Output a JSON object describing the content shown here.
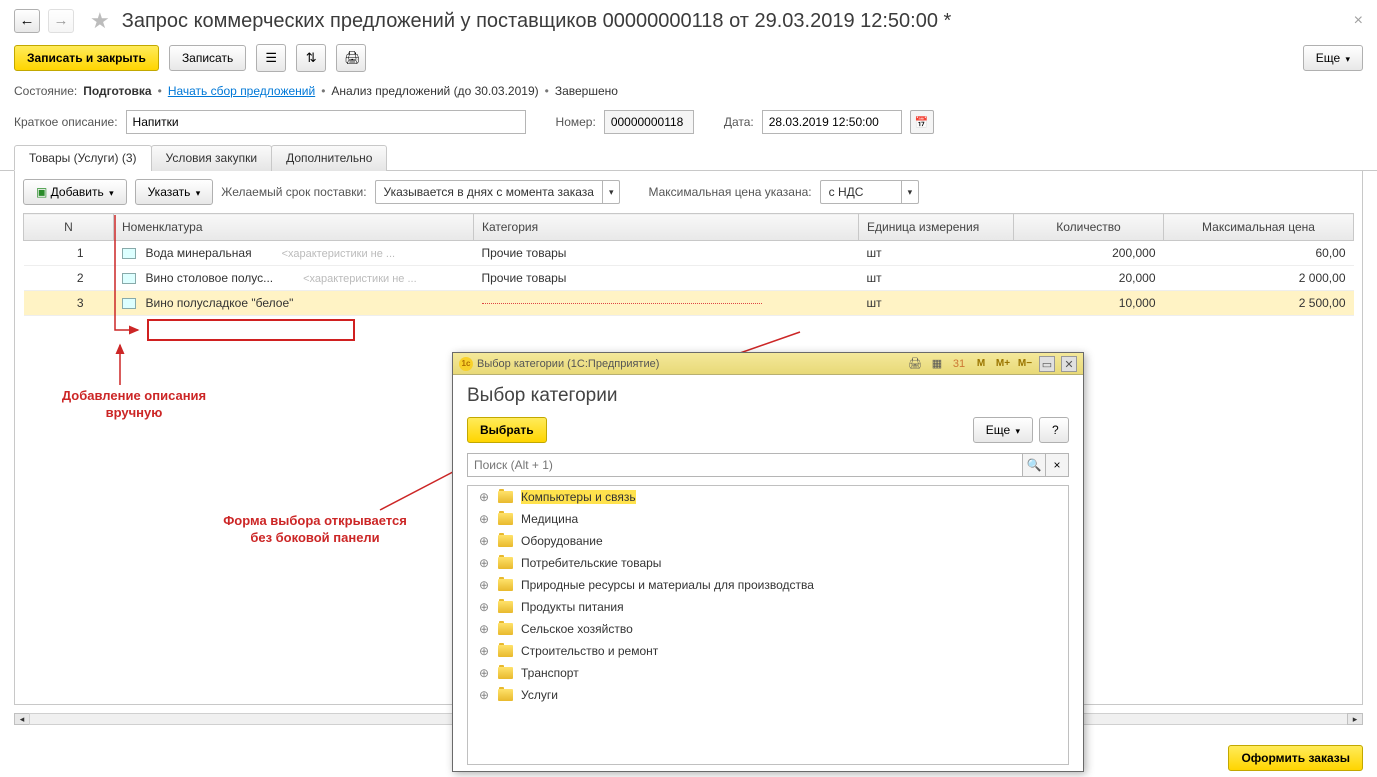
{
  "header": {
    "title": "Запрос коммерческих предложений у поставщиков 00000000118 от 29.03.2019 12:50:00 *"
  },
  "toolbar": {
    "save_close": "Записать и закрыть",
    "save": "Записать",
    "more": "Еще"
  },
  "status": {
    "label": "Состояние:",
    "stage1": "Подготовка",
    "stage2": "Начать сбор предложений",
    "stage3": "Анализ предложений (до 30.03.2019)",
    "stage4": "Завершено"
  },
  "form": {
    "desc_label": "Краткое описание:",
    "desc_value": "Напитки",
    "num_label": "Номер:",
    "num_value": "00000000118",
    "date_label": "Дата:",
    "date_value": "28.03.2019 12:50:00"
  },
  "tabs": {
    "goods": "Товары (Услуги) (3)",
    "conditions": "Условия закупки",
    "additional": "Дополнительно"
  },
  "subbar": {
    "add": "Добавить",
    "find": "Указать",
    "delivery_label": "Желаемый срок поставки:",
    "delivery_value": "Указывается в днях с момента заказа",
    "maxprice_label": "Максимальная цена указана:",
    "maxprice_value": "с НДС"
  },
  "table": {
    "cols": {
      "n": "N",
      "nomen": "Номенклатура",
      "cat": "Категория",
      "unit": "Единица измерения",
      "qty": "Количество",
      "price": "Максимальная цена"
    },
    "hint": "<характеристики не ...",
    "rows": [
      {
        "n": "1",
        "nomen": "Вода минеральная",
        "cat": "Прочие товары",
        "unit": "шт",
        "qty": "200,000",
        "price": "60,00"
      },
      {
        "n": "2",
        "nomen": "Вино столовое полус...",
        "cat": "Прочие товары",
        "unit": "шт",
        "qty": "20,000",
        "price": "2 000,00"
      },
      {
        "n": "3",
        "nomen": "Вино полусладкое \"белое\"",
        "cat": "",
        "unit": "шт",
        "qty": "10,000",
        "price": "2 500,00"
      }
    ]
  },
  "annot": {
    "manual": "Добавление описания\nвручную",
    "form": "Форма выбора открывается\nбез боковой панели"
  },
  "footer": {
    "submit": "Оформить заказы"
  },
  "modal": {
    "titlebar": "Выбор категории  (1С:Предприятие)",
    "title": "Выбор категории",
    "select": "Выбрать",
    "more": "Еще",
    "help": "?",
    "search_ph": "Поиск (Alt + 1)",
    "items": [
      "Компьютеры и связь",
      "Медицина",
      "Оборудование",
      "Потребительские товары",
      "Природные ресурсы и материалы для производства",
      "Продукты питания",
      "Сельское хозяйство",
      "Строительство и ремонт",
      "Транспорт",
      "Услуги"
    ]
  }
}
